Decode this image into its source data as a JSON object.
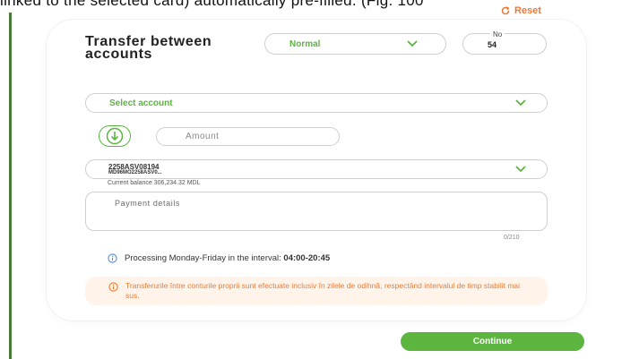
{
  "caption": "linked to the selected card) automatically pre-filled. (Fig. 100",
  "reset_label": "Reset",
  "title": "Transfer between accounts",
  "transfer_type": {
    "value": "Normal"
  },
  "number_field": {
    "label": "No",
    "value": "54"
  },
  "destination_account": {
    "placeholder": "Select account"
  },
  "amount": {
    "placeholder": "Amount"
  },
  "source_account": {
    "line1": "2258ASV08194",
    "line2": "MD96MO2258ASV0...",
    "balance": "Current balance 306,234.32 MDL"
  },
  "payment_details": {
    "placeholder": "Payment details",
    "counter": "0/210"
  },
  "processing_info": {
    "text": "Processing Monday-Friday in the interval:",
    "hours": "04:00-20:45"
  },
  "warning_text": "Transferurile între conturile proprii sunt efectuate inclusiv în zilele de odihnă, respectând intervalul de timp stabilit mai sus.",
  "continue_label": "Continue",
  "colors": {
    "accent": "#5bb53e",
    "warning": "#e67e3a",
    "warning_bg": "#fff3ea",
    "info_icon": "#4a90d9"
  }
}
